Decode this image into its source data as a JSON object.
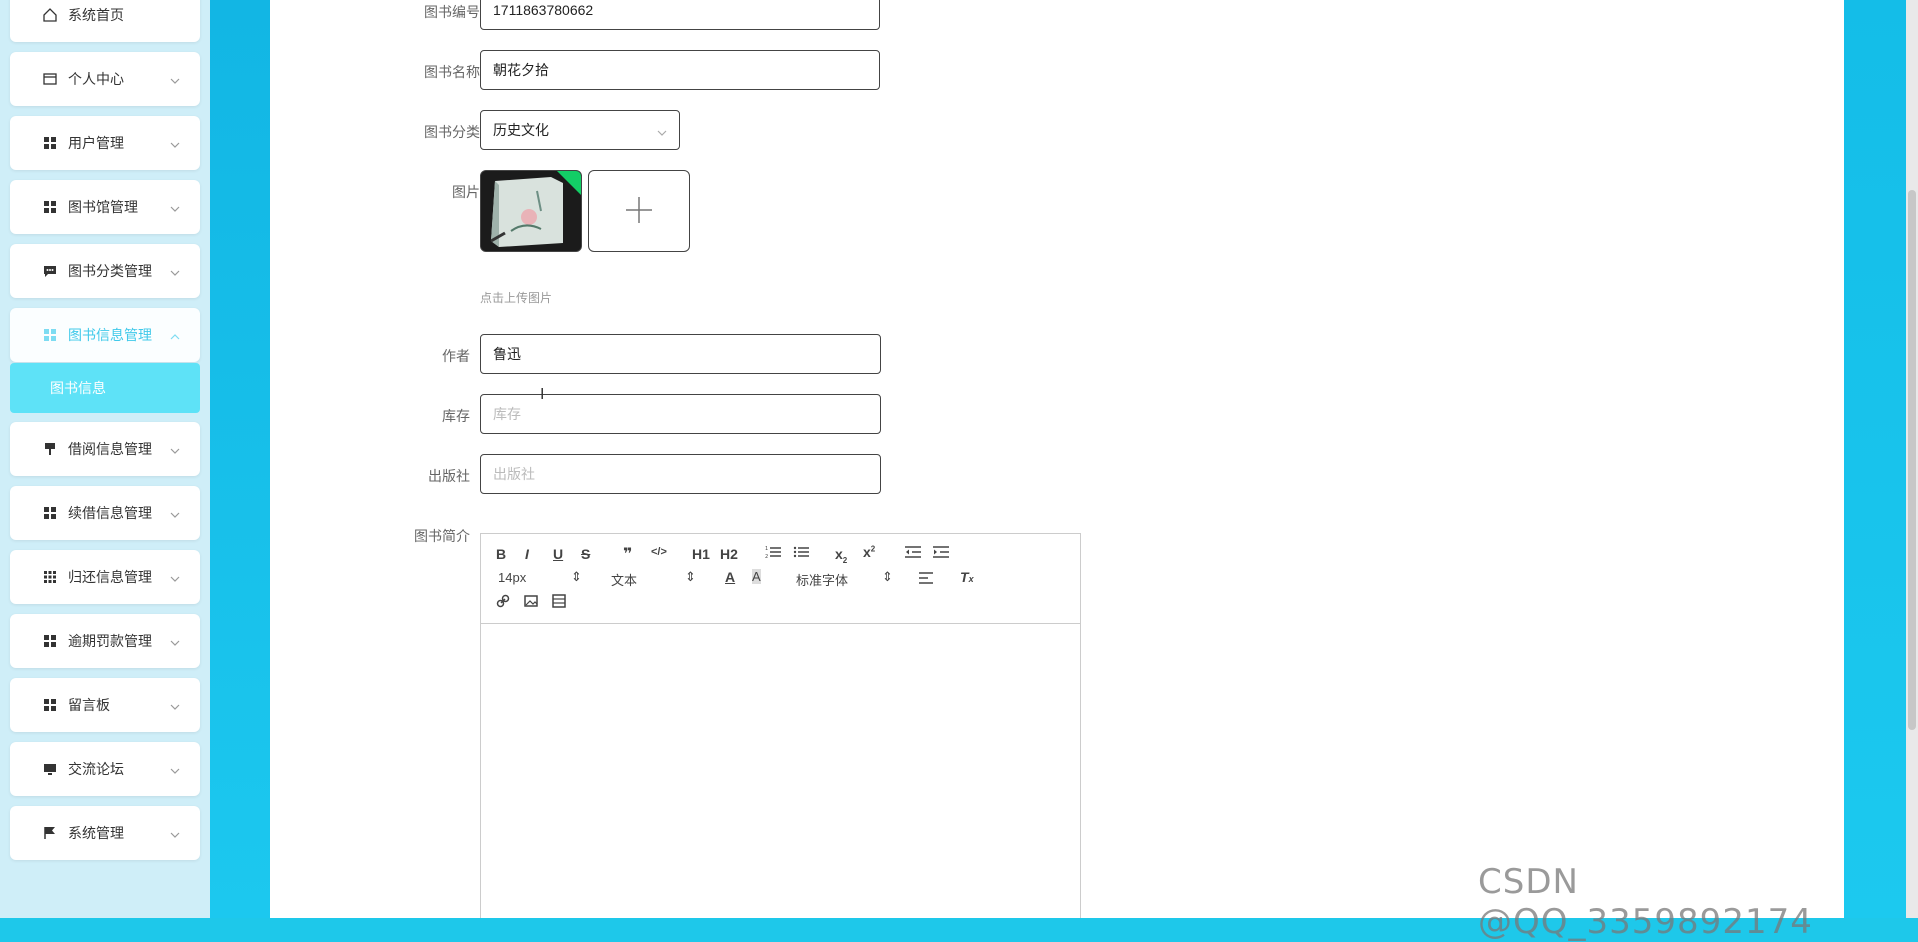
{
  "sidebar": {
    "items": [
      {
        "label": "系统首页",
        "icon": "home-icon"
      },
      {
        "label": "个人中心",
        "icon": "card-icon"
      },
      {
        "label": "用户管理",
        "icon": "grid-icon"
      },
      {
        "label": "图书馆管理",
        "icon": "grid-icon"
      },
      {
        "label": "图书分类管理",
        "icon": "chat-icon"
      },
      {
        "label": "图书信息管理",
        "icon": "grid-icon"
      },
      {
        "label": "借阅信息管理",
        "icon": "stamp-icon"
      },
      {
        "label": "续借信息管理",
        "icon": "grid-icon"
      },
      {
        "label": "归还信息管理",
        "icon": "grid9-icon"
      },
      {
        "label": "逾期罚款管理",
        "icon": "grid-icon"
      },
      {
        "label": "留言板",
        "icon": "grid-icon"
      },
      {
        "label": "交流论坛",
        "icon": "monitor-icon"
      },
      {
        "label": "系统管理",
        "icon": "flag-icon"
      }
    ],
    "submenu_label": "图书信息"
  },
  "form": {
    "book_no": {
      "label": "图书编号",
      "value": "1711863780662"
    },
    "book_name": {
      "label": "图书名称",
      "value": "朝花夕拾"
    },
    "category": {
      "label": "图书分类",
      "value": "历史文化"
    },
    "image": {
      "label": "图片",
      "hint": "点击上传图片"
    },
    "author": {
      "label": "作者",
      "value": "鲁迅"
    },
    "stock": {
      "label": "库存",
      "placeholder": "库存"
    },
    "publisher": {
      "label": "出版社",
      "placeholder": "出版社"
    },
    "intro": {
      "label": "图书简介"
    }
  },
  "editor": {
    "font_size": "14px",
    "header_select": "文本",
    "font_family": "标准字体",
    "buttons": [
      "B",
      "I",
      "U",
      "S",
      "❞",
      "</>",
      "H1",
      "H2"
    ]
  },
  "watermark": "CSDN @QQ_3359892174",
  "colors": {
    "accent": "#40c9ea",
    "submenu_bg": "#5ee2f7",
    "background": "#1ec8ea"
  }
}
